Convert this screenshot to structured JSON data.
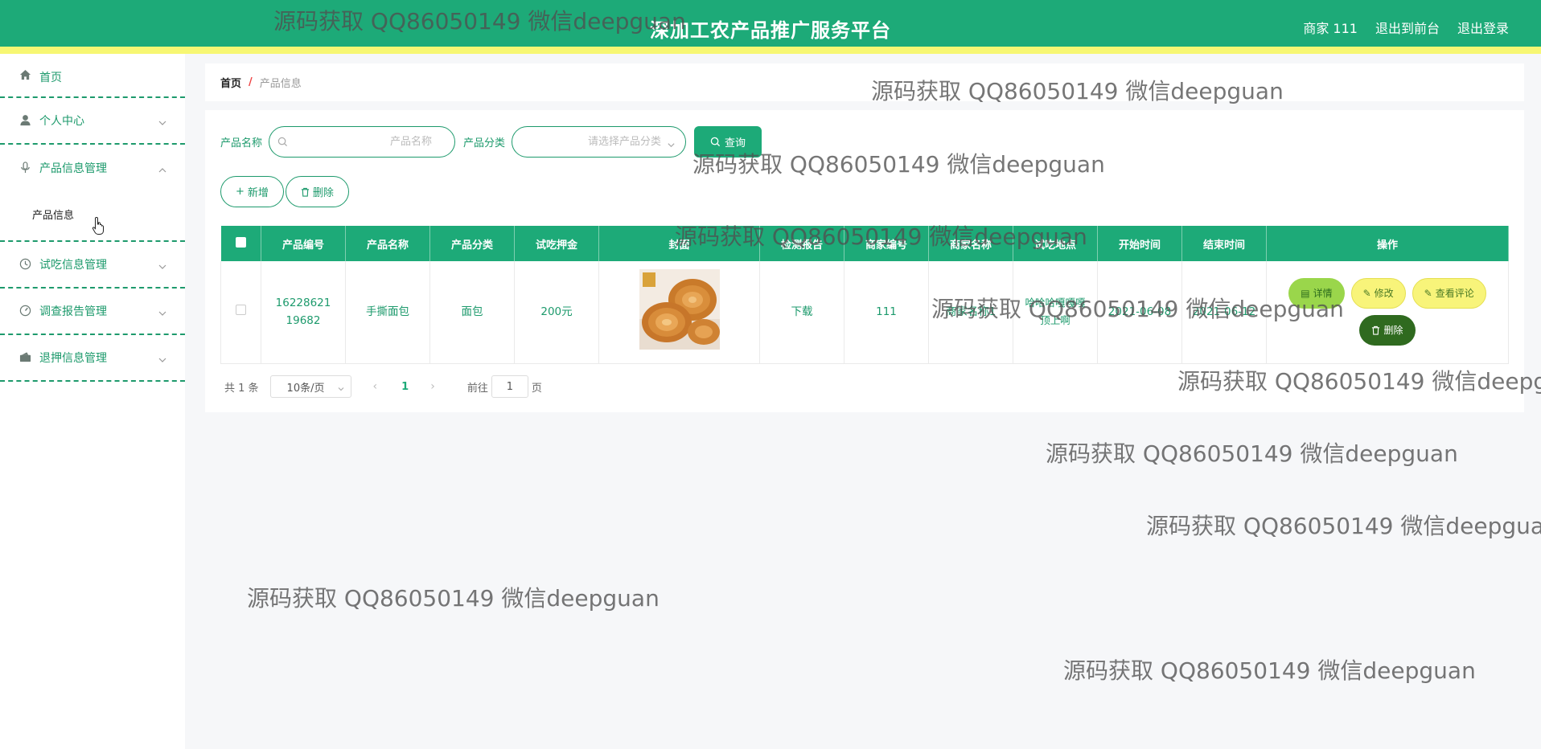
{
  "header": {
    "title": "深加工农产品推广服务平台",
    "links": [
      "商家 111",
      "退出到前台",
      "退出登录"
    ]
  },
  "sidebar": {
    "items": [
      {
        "label": "首页",
        "icon": "home-icon"
      },
      {
        "label": "个人中心",
        "icon": "user-icon"
      },
      {
        "label": "产品信息管理",
        "icon": "mic-icon",
        "expanded": true,
        "children": [
          "产品信息"
        ]
      },
      {
        "label": "试吃信息管理",
        "icon": "clock-icon"
      },
      {
        "label": "调查报告管理",
        "icon": "gauge-icon"
      },
      {
        "label": "退押信息管理",
        "icon": "wallet-icon"
      }
    ]
  },
  "breadcrumb": {
    "home": "首页",
    "separator": "/",
    "current": "产品信息"
  },
  "search": {
    "name_label": "产品名称",
    "name_placeholder": "产品名称",
    "category_label": "产品分类",
    "category_placeholder": "请选择产品分类",
    "button": "查询"
  },
  "actions": {
    "add": "新增",
    "delete": "删除"
  },
  "table": {
    "columns": [
      "产品编号",
      "产品名称",
      "产品分类",
      "试吃押金",
      "封面",
      "检测报告",
      "商家编号",
      "商家名称",
      "试吃地点",
      "开始时间",
      "结束时间",
      "操作"
    ],
    "rows": [
      {
        "code": "1622862119682",
        "name": "手撕面包",
        "category": "面包",
        "deposit": "200元",
        "cover": "bread-image",
        "report": "下载",
        "merchant_code": "111",
        "merchant_name": "商家名称1",
        "location": "哈哈哈嘎嘎嘎顶上啊",
        "start": "2021-06-08",
        "end": "2021-06-12",
        "ops": {
          "detail": "详情",
          "edit": "修改",
          "comment": "查看评论",
          "delete": "删除"
        }
      }
    ]
  },
  "pagination": {
    "total": "共 1 条",
    "page_size": "10条/页",
    "current_page": "1",
    "goto_label": "前往",
    "goto_value": "1",
    "page_suffix": "页"
  },
  "watermark": "源码获取 QQ86050149 微信deepguan",
  "colors": {
    "primary": "#1daa78",
    "stripe": "#f7f773",
    "detail": "#9ad64b",
    "edit": "#f8f47a",
    "delete": "#2f6a1f"
  }
}
